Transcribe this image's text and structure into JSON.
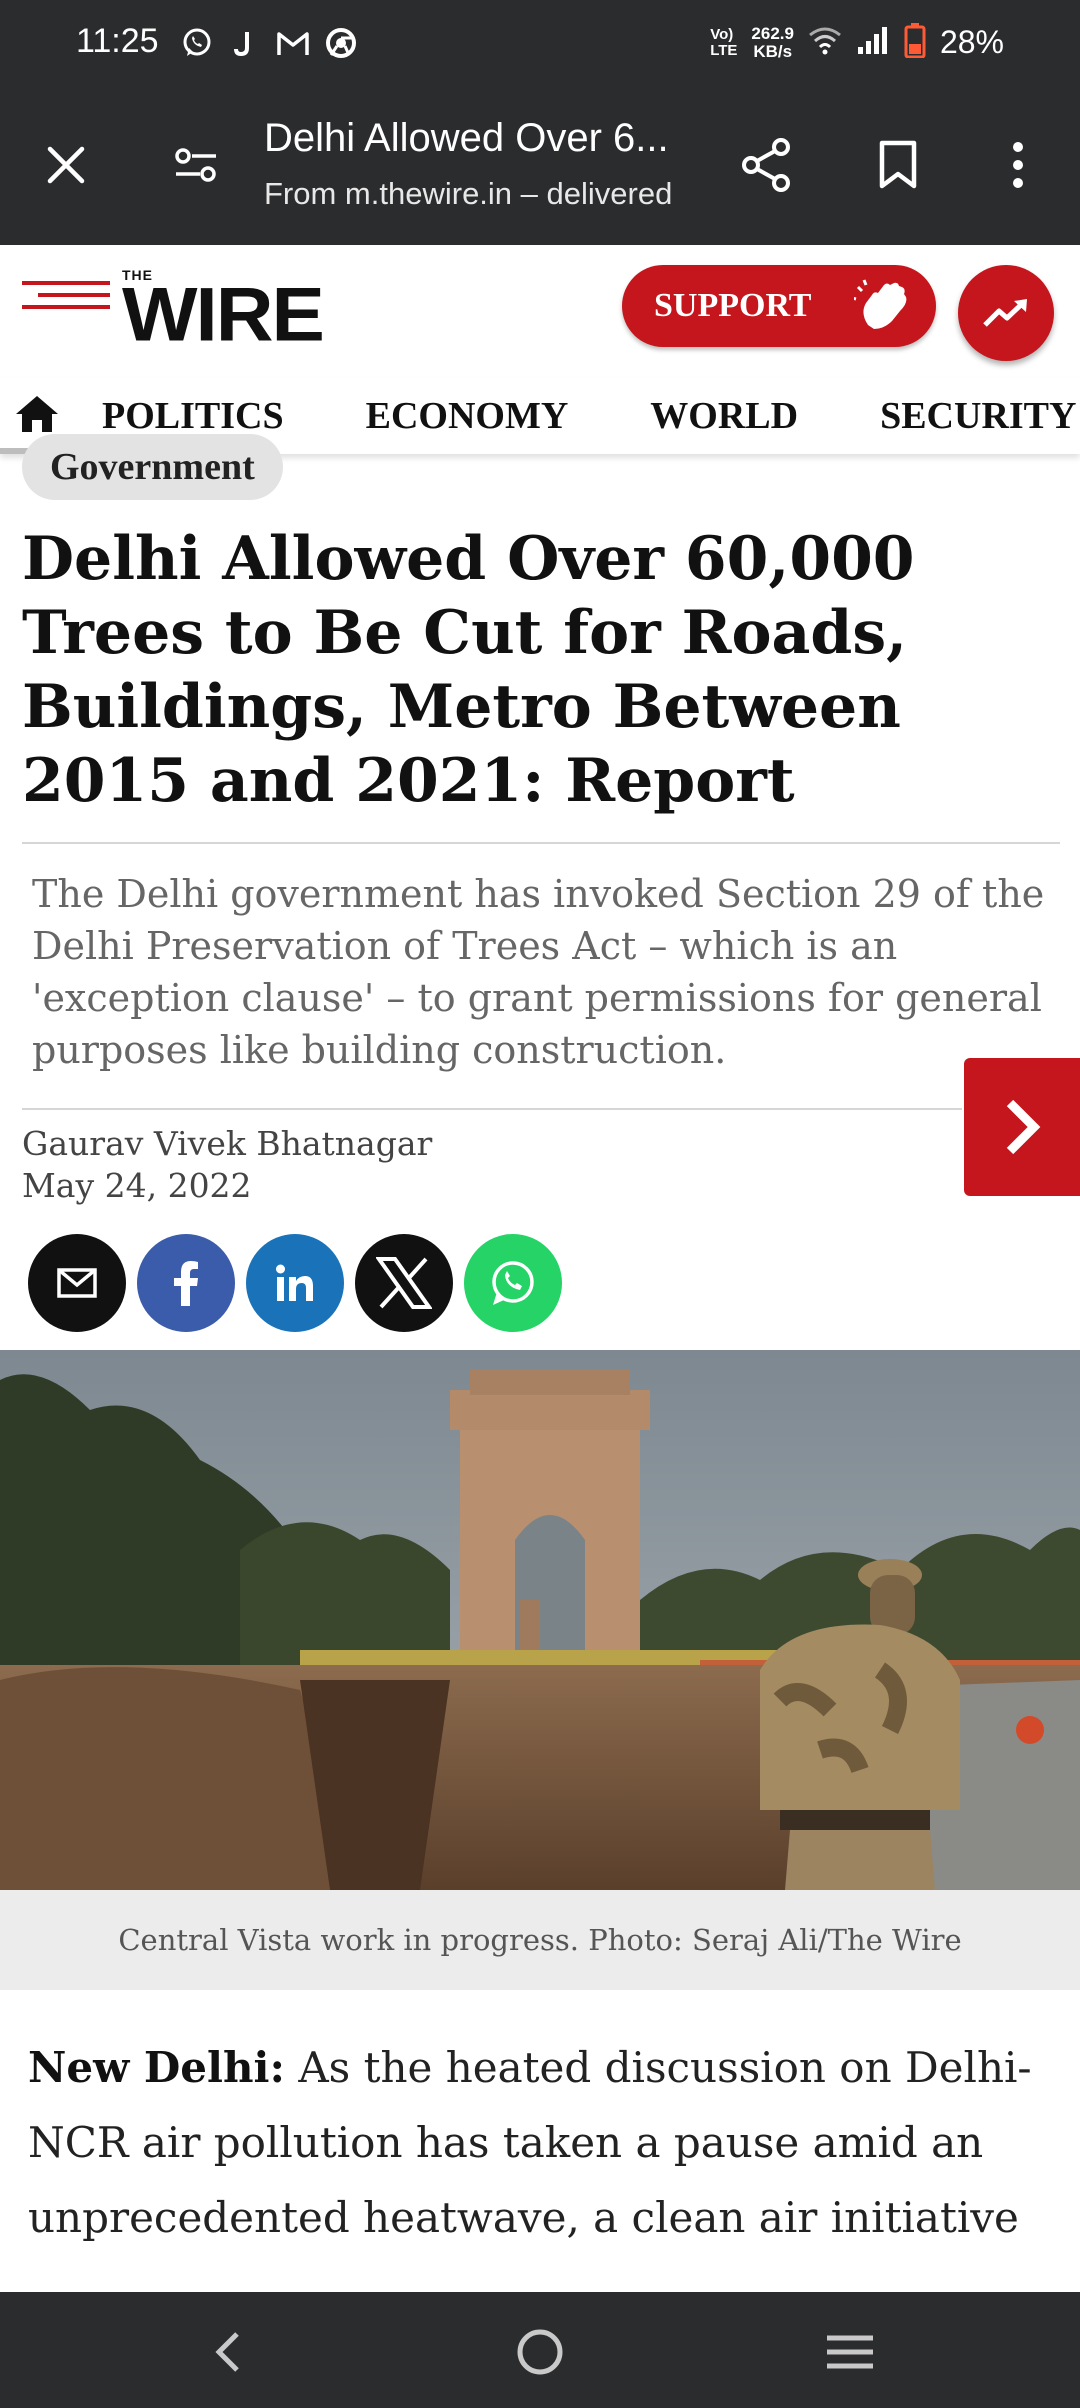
{
  "status_bar": {
    "time": "11:25",
    "net_speed_value": "262.9",
    "net_speed_unit": "KB/s",
    "volte_top": "Vo)",
    "volte_bottom": "LTE",
    "battery": "28%",
    "icons": [
      "whatsapp-icon",
      "j-app-icon",
      "gmail-icon",
      "chrome-icon",
      "wifi-icon",
      "signal-icon",
      "battery-icon"
    ]
  },
  "browser": {
    "title": "Delhi Allowed Over 6...",
    "url_text": "From m.thewire.in – delivered",
    "icons": [
      "close-icon",
      "page-settings-icon",
      "share-icon",
      "bookmark-icon",
      "more-vert-icon"
    ]
  },
  "site": {
    "logo_small": "THE",
    "logo_main": "WIRE",
    "support_label": "SUPPORT",
    "accent": "#c4161c"
  },
  "nav": {
    "items": [
      "POLITICS",
      "ECONOMY",
      "WORLD",
      "SECURITY"
    ]
  },
  "article": {
    "category": "Government",
    "headline": "Delhi Allowed Over 60,000 Trees to Be Cut for Roads, Buildings, Metro Between 2015 and 2021: Report",
    "standfirst": "The Delhi government has invoked Section 29 of the Delhi Preservation of Trees Act – which is an 'exception clause' – to grant permissions for general purposes like building construction.",
    "author": "Gaurav Vivek Bhatnagar",
    "date": "May 24, 2022",
    "share": [
      {
        "name": "email",
        "color": "#111111"
      },
      {
        "name": "facebook",
        "color": "#3b5bab"
      },
      {
        "name": "linkedin",
        "color": "#1a73b8"
      },
      {
        "name": "x",
        "color": "#111111"
      },
      {
        "name": "whatsapp",
        "color": "#25d366"
      }
    ],
    "caption": "Central Vista work in progress. Photo: Seraj Ali/The Wire",
    "body_lead": "New Delhi:",
    "body_text": " As the heated discussion on Delhi-NCR air pollution has taken a pause amid an unprecedented heatwave, a clean air initiative in its report has revealed that the Delhi"
  }
}
